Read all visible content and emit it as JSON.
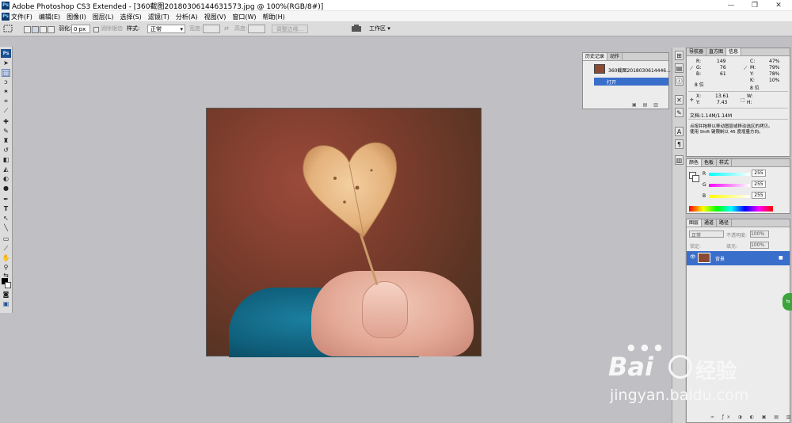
{
  "window": {
    "title": "Adobe Photoshop CS3 Extended - [360截图20180306144631573.jpg @ 100%(RGB/8#)]",
    "app_icon": "Ps",
    "controls": [
      "—",
      "❐",
      "✕"
    ]
  },
  "menu": {
    "items": [
      "文件(F)",
      "编辑(E)",
      "图像(I)",
      "图层(L)",
      "选择(S)",
      "滤镜(T)",
      "分析(A)",
      "视图(V)",
      "窗口(W)",
      "帮助(H)"
    ]
  },
  "options": {
    "feather_label": "羽化:",
    "feather_value": "0 px",
    "antialias_label": "消除锯齿",
    "style_label": "样式:",
    "style_value": "正常",
    "width_label": "宽度:",
    "height_label": "高度:",
    "refine_label": "调整边缘...",
    "workspace_label": "工作区 ▾"
  },
  "history_panel": {
    "tabs": [
      "历史记录",
      "动作"
    ],
    "snapshot_name": "360截图2018030614446...",
    "steps": [
      "打开"
    ]
  },
  "info_panel": {
    "tabs": [
      "导航器",
      "直方图",
      "信息"
    ],
    "r_label": "R:",
    "r": "149",
    "g_label": "G:",
    "g": "76",
    "b_label": "B:",
    "b": "61",
    "bit_left": "8 位",
    "c_label": "C:",
    "c": "47%",
    "m_label": "M:",
    "m": "79%",
    "y_label": "Y:",
    "y": "78%",
    "k_label": "K:",
    "k": "10%",
    "bit_right": "8 位",
    "x_label": "X:",
    "x": "13.61",
    "yy_label": "Y:",
    "yy": "7.43",
    "w_label": "W:",
    "h_label": "H:",
    "doc": "文档:1.14M/1.14M",
    "hint1": "点按并拖移以移动图层或移动选区的拷贝。",
    "hint2": "使用 Shift 键限制以 45 度增量方向。"
  },
  "color_panel": {
    "tabs": [
      "颜色",
      "色板",
      "样式"
    ],
    "r_label": "R",
    "r_value": "255",
    "g_label": "G",
    "g_value": "255",
    "b_label": "B",
    "b_value": "255"
  },
  "layers_panel": {
    "tabs": [
      "图层",
      "通道",
      "路径"
    ],
    "blend_mode": "正常",
    "opacity_label": "不透明度:",
    "opacity_value": "100%",
    "lock_label": "锁定:",
    "fill_label": "填充:",
    "fill_value": "100%",
    "layer_name": "背景"
  },
  "watermark": {
    "brand": "Bai",
    "brand2": "经验",
    "url": "jingyan.baidu.com"
  },
  "colors": {
    "selection": "#3a6ecb",
    "canvas_bg": "#c0c0c4",
    "ps_blue": "#1b4f93"
  }
}
